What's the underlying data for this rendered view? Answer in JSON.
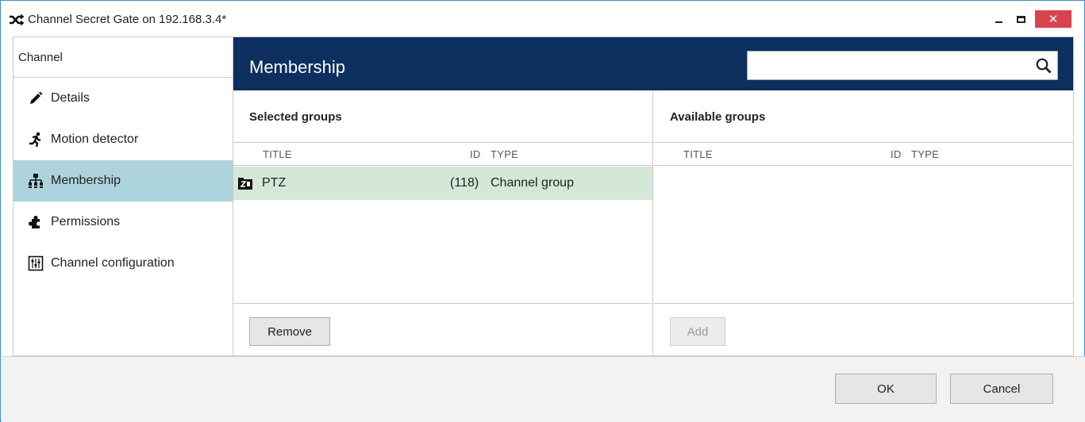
{
  "window": {
    "title": "Channel Secret Gate on 192.168.3.4*",
    "close_glyph": "✕",
    "icon": "shuffle-icon"
  },
  "sidebar": {
    "header": "Channel",
    "items": [
      {
        "label": "Details",
        "icon": "pencil-icon"
      },
      {
        "label": "Motion detector",
        "icon": "running-person-icon"
      },
      {
        "label": "Membership",
        "icon": "hierarchy-icon",
        "active": true
      },
      {
        "label": "Permissions",
        "icon": "puzzle-icon"
      },
      {
        "label": "Channel configuration",
        "icon": "sliders-icon"
      }
    ]
  },
  "main": {
    "title": "Membership",
    "search": {
      "value": "",
      "placeholder": ""
    },
    "selected": {
      "title": "Selected groups",
      "columns": {
        "title": "TITLE",
        "id": "ID",
        "type": "TYPE"
      },
      "rows": [
        {
          "title": "PTZ",
          "id": "(118)",
          "type": "Channel group",
          "icon": "group-folder-icon"
        }
      ],
      "remove_label": "Remove"
    },
    "available": {
      "title": "Available groups",
      "columns": {
        "title": "TITLE",
        "id": "ID",
        "type": "TYPE"
      },
      "rows": [],
      "add_label": "Add"
    }
  },
  "footer": {
    "ok_label": "OK",
    "cancel_label": "Cancel"
  },
  "colors": {
    "header_bg": "#0c2f5f",
    "active_item_bg": "#add4dc",
    "selected_row_bg": "#d4e8d8",
    "close_button_bg": "#d9434c",
    "window_border": "#3a8fd6"
  }
}
